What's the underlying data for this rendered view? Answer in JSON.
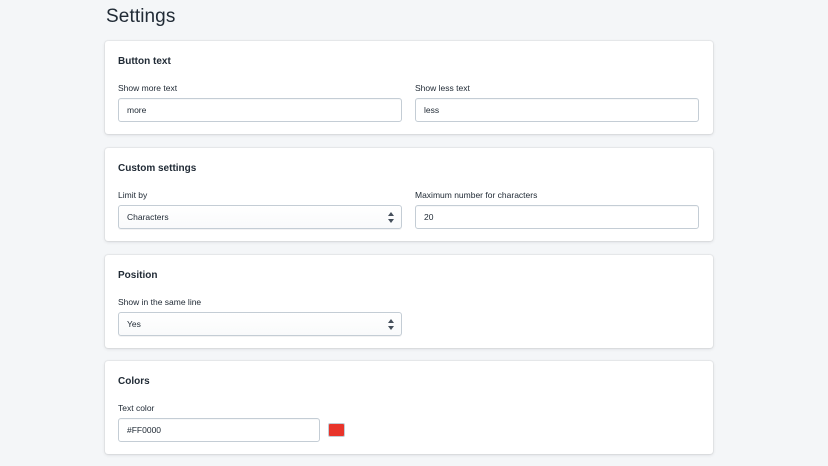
{
  "page": {
    "title": "Settings"
  },
  "button_text": {
    "title": "Button text",
    "show_more": {
      "label": "Show more text",
      "value": "more"
    },
    "show_less": {
      "label": "Show less text",
      "value": "less"
    }
  },
  "custom_settings": {
    "title": "Custom settings",
    "limit_by": {
      "label": "Limit by",
      "selected": "Characters"
    },
    "max_characters": {
      "label": "Maximum number for characters",
      "value": "20"
    }
  },
  "position": {
    "title": "Position",
    "same_line": {
      "label": "Show in the same line",
      "selected": "Yes"
    }
  },
  "colors": {
    "title": "Colors",
    "text_color": {
      "label": "Text color",
      "value": "#FF0000",
      "swatch_color": "#e8342a"
    }
  },
  "icons": {
    "select_arrows": "chevron-up-down-icon"
  }
}
